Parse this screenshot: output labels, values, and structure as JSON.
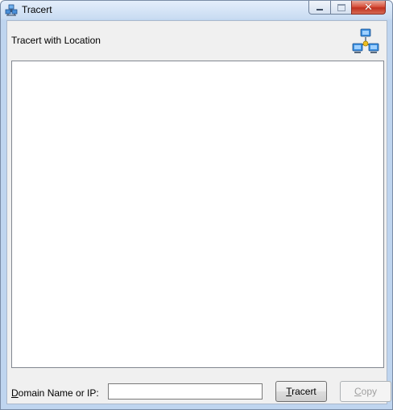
{
  "window": {
    "title": "Tracert",
    "app_icon": "network-icon",
    "controls": [
      "minimize-icon",
      "maximize-icon",
      "close-icon"
    ],
    "close_glyph": "✕"
  },
  "header": {
    "label": "Tracert with Location",
    "icon": "network-topology-icon"
  },
  "output": {
    "text": ""
  },
  "form": {
    "domain_label_mnemonic": "D",
    "domain_label_rest": "omain Name or IP:",
    "domain_value": ""
  },
  "buttons": {
    "tracert_mnemonic": "T",
    "tracert_rest": "racert",
    "copy_mnemonic": "C",
    "copy_rest": "opy"
  },
  "colors": {
    "title_bar": "#c9dcf2",
    "client_bg": "#f0f0f0",
    "close_button": "#c0311f",
    "disabled_text": "#a0a0a0"
  }
}
